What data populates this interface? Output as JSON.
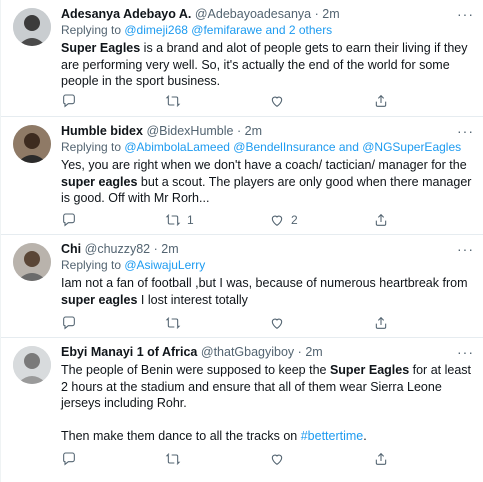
{
  "tweets": [
    {
      "name": "Adesanya Adebayo A.",
      "handle": "@Adebayoadesanya",
      "time": "2m",
      "reply_prefix": "Replying to ",
      "reply_links": [
        "@dimeji268",
        "@femifarawe and 2 others"
      ],
      "text_parts": [
        {
          "t": "Super Eagles",
          "b": true
        },
        {
          "t": " is a brand and alot of people gets to earn their living if they are performing very well. So, it's actually the end of the world for some people in the sport business.",
          "b": false
        }
      ],
      "retweets": "",
      "likes": ""
    },
    {
      "name": "Humble bidex",
      "handle": "@BidexHumble",
      "time": "2m",
      "reply_prefix": "Replying to ",
      "reply_links": [
        "@AbimbolaLameed",
        "@BendelInsurance and @NGSuperEagles"
      ],
      "text_parts": [
        {
          "t": "Yes, you are right when we don't have a coach/ tactician/ manager for the ",
          "b": false
        },
        {
          "t": "super eagles",
          "b": true
        },
        {
          "t": " but a scout. The players are only good when there manager is good. Off with Mr Rorh...",
          "b": false
        }
      ],
      "retweets": "1",
      "likes": "2"
    },
    {
      "name": "Chi",
      "handle": "@chuzzy82",
      "time": "2m",
      "reply_prefix": "Replying to ",
      "reply_links": [
        "@AsiwajuLerry"
      ],
      "text_parts": [
        {
          "t": "Iam not a fan of football  ,but I was, because of numerous heartbreak from ",
          "b": false
        },
        {
          "t": "super eagles",
          "b": true
        },
        {
          "t": " I lost interest totally",
          "b": false
        }
      ],
      "retweets": "",
      "likes": ""
    },
    {
      "name": "Ebyi Manayi 1 of Africa",
      "handle": "@thatGbagyiboy",
      "time": "2m",
      "reply_prefix": "",
      "reply_links": [],
      "text_parts": [
        {
          "t": "The people  of Benin were supposed to keep the ",
          "b": false
        },
        {
          "t": "Super Eagles",
          "b": true
        },
        {
          "t": " for at least 2 hours at the stadium and ensure that all of them wear Sierra  Leone jerseys including  Rohr.",
          "b": false
        }
      ],
      "text2_prefix": "Then make them dance to all the tracks on ",
      "text2_link": "#bettertime",
      "text2_suffix": ".",
      "retweets": "",
      "likes": ""
    }
  ],
  "dot": "·",
  "more_label": "···",
  "icons": [
    "reply-icon",
    "retweet-icon",
    "like-icon",
    "share-icon",
    "more-icon"
  ]
}
